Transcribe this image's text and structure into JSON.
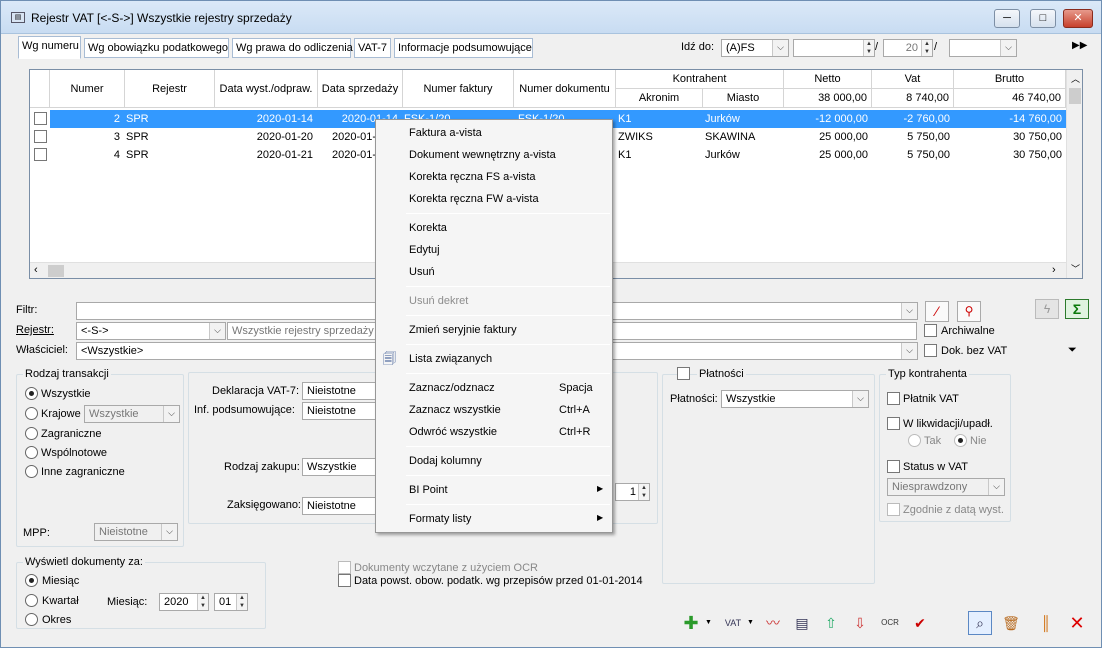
{
  "window": {
    "title": "Rejestr VAT   [<-S->]   Wszystkie rejestry sprzedaży",
    "minimize": "─",
    "maximize": "□",
    "close": "✕"
  },
  "tabs": [
    "Wg numeru",
    "Wg obowiązku podatkowego",
    "Wg prawa do odliczenia",
    "VAT-7",
    "Informacje podsumowujące"
  ],
  "goto": {
    "label": "Idź do:",
    "value": "(A)FS",
    "field2": "",
    "num": "20",
    "field4": ""
  },
  "grid": {
    "headers": {
      "numer": "Numer",
      "rejestr": "Rejestr",
      "data_wyst": "Data wyst./odpraw.",
      "data_sprz": "Data sprzedaży",
      "numer_faktury": "Numer faktury",
      "numer_dok": "Numer dokumentu",
      "kontrahent": "Kontrahent",
      "akronim": "Akronim",
      "miasto": "Miasto",
      "netto": "Netto",
      "vat": "Vat",
      "brutto": "Brutto"
    },
    "totals": {
      "netto": "38 000,00",
      "vat": "8 740,00",
      "brutto": "46 740,00"
    },
    "rows": [
      {
        "numer": "2",
        "rejestr": "SPR",
        "data_wyst": "2020-01-14",
        "data_sprz": "2020-01-14",
        "numer_faktury": "FSK-1/20",
        "numer_dok": "FSK-1/20",
        "akronim": "K1",
        "miasto": "Jurków",
        "netto": "-12 000,00",
        "vat": "-2 760,00",
        "brutto": "-14 760,00"
      },
      {
        "numer": "3",
        "rejestr": "SPR",
        "data_wyst": "2020-01-20",
        "data_sprz": "2020-01-",
        "numer_faktury": "",
        "numer_dok": "",
        "akronim": "ZWIKS",
        "miasto": "SKAWINA",
        "netto": "25 000,00",
        "vat": "5 750,00",
        "brutto": "30 750,00"
      },
      {
        "numer": "4",
        "rejestr": "SPR",
        "data_wyst": "2020-01-21",
        "data_sprz": "2020-01-",
        "numer_faktury": "",
        "numer_dok": "",
        "akronim": "K1",
        "miasto": "Jurków",
        "netto": "25 000,00",
        "vat": "5 750,00",
        "brutto": "30 750,00"
      }
    ]
  },
  "filters": {
    "filtr_label": "Filtr:",
    "filtr_value": "",
    "rejestr_label": "Rejestr:",
    "rejestr_value": "<-S->",
    "rejestr_desc": "Wszystkie rejestry sprzedaży",
    "wlasciciel_label": "Właściciel:",
    "wlasciciel_value": "<Wszystkie>",
    "archiwalne": "Archiwalne",
    "dok_bez_vat": "Dok. bez VAT"
  },
  "rodzaj": {
    "title": "Rodzaj transakcji",
    "wszystkie": "Wszystkie",
    "krajowe": "Krajowe",
    "krajowe_value": "Wszystkie",
    "zagraniczne": "Zagraniczne",
    "wspolnotowe": "Wspólnotowe",
    "inne": "Inne zagraniczne",
    "mpp_label": "MPP:",
    "mpp_value": "Nieistotne"
  },
  "deklaracja": {
    "vat7_label": "Deklaracja VAT-7:",
    "vat7_value": "Nieistotne",
    "inf_label": "Inf. podsumowujące:",
    "inf_value": "Nieistotne",
    "zakup_label": "Rodzaj zakupu:",
    "zakup_value": "Wszystkie",
    "zaks_label": "Zaksięgowano:",
    "zaks_value": "Nieistotne",
    "hidden_spin": "1"
  },
  "platnosci": {
    "title": "Płatności",
    "label": "Płatności:",
    "value": "Wszystkie"
  },
  "typ": {
    "title": "Typ kontrahenta",
    "platnik": "Płatnik VAT",
    "likwidacja": "W likwidacji/upadł.",
    "tak": "Tak",
    "nie": "Nie",
    "status": "Status w VAT",
    "status_value": "Niesprawdzony",
    "zgodnie": "Zgodnie z datą wyst."
  },
  "wyswietl": {
    "title": "Wyświetl dokumenty za:",
    "miesiac": "Miesiąc",
    "kwartal": "Kwartał",
    "okres": "Okres",
    "mies_label": "Miesiąc:",
    "rok": "2020",
    "mies": "01"
  },
  "extra": {
    "ocr": "Dokumenty wczytane z użyciem OCR",
    "data_powst": "Data powst. obow. podatk. wg przepisów przed 01-01-2014"
  },
  "context_menu": {
    "items": [
      {
        "label": "Faktura a-vista",
        "shortcut": ""
      },
      {
        "label": "Dokument wewnętrzny a-vista",
        "shortcut": ""
      },
      {
        "label": "Korekta ręczna FS a-vista",
        "shortcut": ""
      },
      {
        "label": "Korekta ręczna FW a-vista",
        "shortcut": ""
      },
      {
        "label": "Korekta",
        "shortcut": ""
      },
      {
        "label": "Edytuj",
        "shortcut": ""
      },
      {
        "label": "Usuń",
        "shortcut": ""
      },
      {
        "label": "Usuń dekret",
        "shortcut": ""
      },
      {
        "label": "Zmień seryjnie faktury",
        "shortcut": ""
      },
      {
        "label": "Lista związanych",
        "shortcut": ""
      },
      {
        "label": "Zaznacz/odznacz",
        "shortcut": "Spacja"
      },
      {
        "label": "Zaznacz wszystkie",
        "shortcut": "Ctrl+A"
      },
      {
        "label": "Odwróć wszystkie",
        "shortcut": "Ctrl+R"
      },
      {
        "label": "Dodaj kolumny",
        "shortcut": ""
      },
      {
        "label": "BI Point",
        "shortcut": ""
      },
      {
        "label": "Formaty listy",
        "shortcut": ""
      }
    ]
  },
  "colors": {
    "selection": "#3399ff",
    "accent": "#1a64b4"
  }
}
